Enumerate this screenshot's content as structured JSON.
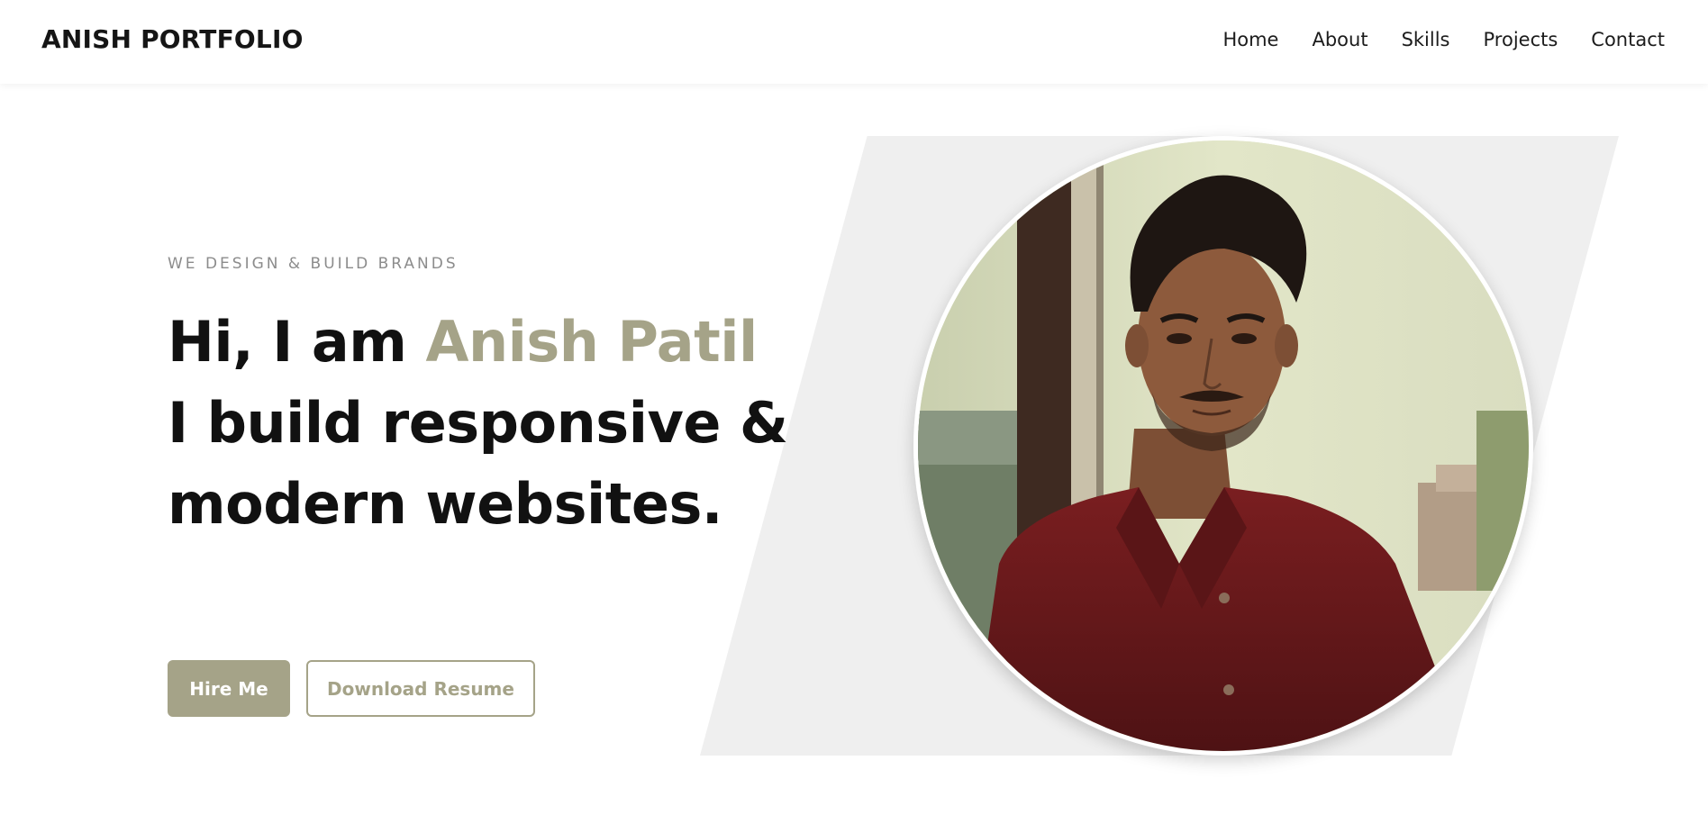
{
  "brand": "ANISH PORTFOLIO",
  "nav": {
    "items": [
      {
        "label": "Home"
      },
      {
        "label": "About"
      },
      {
        "label": "Skills"
      },
      {
        "label": "Projects"
      },
      {
        "label": "Contact"
      }
    ]
  },
  "hero": {
    "tagline": "WE DESIGN & BUILD BRANDS",
    "greeting": "Hi, I am",
    "name": "Anish Patil",
    "line2": "I build responsive &",
    "line3": "modern websites.",
    "primary_button": "Hire Me",
    "secondary_button": "Download Resume"
  },
  "colors": {
    "accent": "#a5a388",
    "text_dark": "#111111",
    "tagline": "#8c8c8c",
    "shape_bg": "#efefef",
    "shirt": "#6b1a1c"
  },
  "icons": {
    "profile_photo": "portrait-photo"
  }
}
